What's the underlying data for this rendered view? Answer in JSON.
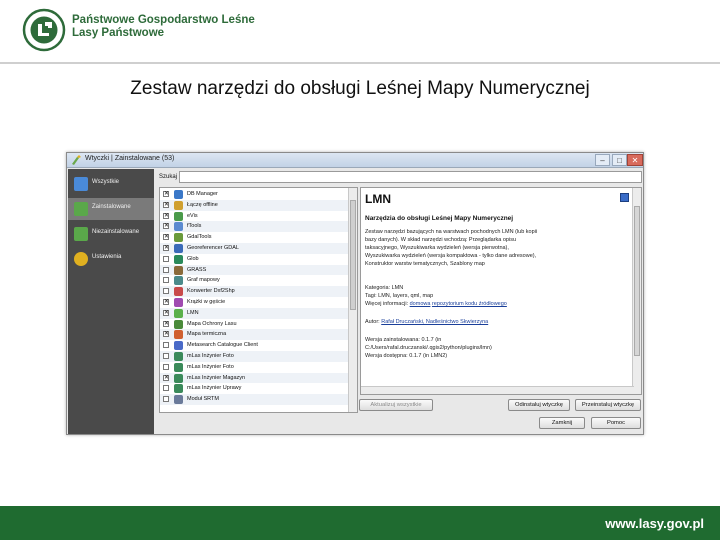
{
  "header": {
    "org_line1": "Państwowe Gospodarstwo Leśne",
    "org_line2": "Lasy Państwowe",
    "logo_text": "LASY PAŃSTWOWE",
    "brand_color": "#2e6b3a"
  },
  "slide_title": "Zestaw narzędzi do obsługi Leśnej Mapy Numerycznej",
  "window": {
    "title": "Wtyczki | Zainstalowane (53)",
    "controls": [
      "minimize-icon",
      "maximize-icon",
      "close-icon"
    ]
  },
  "nav": {
    "items": [
      {
        "label": "Wszystkie",
        "icon": "plugins-all-icon",
        "color": "#4a8ad8"
      },
      {
        "label": "Zainstalowane",
        "icon": "installed-icon",
        "color": "#5aa84a",
        "selected": true
      },
      {
        "label": "Niezainstalowane",
        "icon": "not-installed-icon",
        "color": "#5aa84a"
      },
      {
        "label": "Ustawienia",
        "icon": "settings-gear-icon",
        "color": "#e0b020"
      }
    ]
  },
  "search": {
    "label": "Szukaj",
    "value": ""
  },
  "plugins": [
    {
      "name": "DB Manager",
      "checked": true,
      "icon_color": "#3a78c8"
    },
    {
      "name": "Łączę offline",
      "checked": true,
      "icon_color": "#d0a030"
    },
    {
      "name": "eVis",
      "checked": true,
      "icon_color": "#4a9a4a"
    },
    {
      "name": "fTools",
      "checked": true,
      "icon_color": "#5a8ad0"
    },
    {
      "name": "GdalTools",
      "checked": true,
      "icon_color": "#6a9a3a"
    },
    {
      "name": "Georeferencer GDAL",
      "checked": true,
      "icon_color": "#3a6ab8"
    },
    {
      "name": "Glob",
      "checked": false,
      "icon_color": "#2a8a5a"
    },
    {
      "name": "GRASS",
      "checked": false,
      "icon_color": "#8a6a3a"
    },
    {
      "name": "Graf mapowy",
      "checked": false,
      "icon_color": "#4a8a8a"
    },
    {
      "name": "Konwerter Dxf2Shp",
      "checked": false,
      "icon_color": "#c84a4a"
    },
    {
      "name": "Krążki w gęście",
      "checked": true,
      "icon_color": "#a04ab0"
    },
    {
      "name": "LMN",
      "checked": true,
      "icon_color": "#5ab04a"
    },
    {
      "name": "Mapa Ochrony Lasu",
      "checked": true,
      "icon_color": "#4a8a3a"
    },
    {
      "name": "Mapa termiczna",
      "checked": true,
      "icon_color": "#d06030"
    },
    {
      "name": "Metasearch Catalogue Client",
      "checked": false,
      "icon_color": "#4a6ac8"
    },
    {
      "name": "mLas Inżynier Foto",
      "checked": false,
      "icon_color": "#3a8a5a"
    },
    {
      "name": "mLas Inżynier Foto",
      "checked": false,
      "icon_color": "#3a8a5a"
    },
    {
      "name": "mLas Inżynier Magazyn",
      "checked": true,
      "icon_color": "#3a8a5a"
    },
    {
      "name": "mLas Inżynier Uprawy",
      "checked": false,
      "icon_color": "#3a8a5a"
    },
    {
      "name": "Moduł SRTM",
      "checked": false,
      "icon_color": "#6a7a9a"
    }
  ],
  "details": {
    "title": "LMN",
    "heading": "Narzędzia do obsługi Leśnej Mapy Numerycznej",
    "desc_lines": [
      "Zestaw narzędzi bazujących na warstwach pochodnych LMN (lub kopii",
      "bazy danych). W skład narzędzi wchodzą: Przeglądarka opisu",
      "taksacyjnego, Wyszukiwarka wydzieleń (wersja pierwotna),",
      "Wyszukiwarka wydzieleń (wersja kompaktowa - tylko dane adresowe),",
      "Konstruktor warstw tematycznych, Szablony map"
    ],
    "category": "Kategoria: LMN",
    "tags": "Tagi: LMN, layers, qml, map",
    "more_info_prefix": "Więcej informacji:",
    "links": [
      "domowa",
      "repozytorium kodu źródłowego"
    ],
    "author_prefix": "Autor:",
    "author": "Rafał Druczański, Nadleśnictwo Skwierzyna",
    "installed_version": "Wersja zainstalowana: 0.1.7 (in",
    "installed_path": "C:/Users/rafal.druczanski/.qgis2/python/plugins/lmn)",
    "available_version": "Wersja dostępna: 0.1.7 (in LMN2)"
  },
  "buttons": {
    "upgrade_all": "Aktualizuj wszystkie",
    "uninstall": "Odinstaluj wtyczkę",
    "reinstall": "Przeinstaluj wtyczkę",
    "close": "Zamknij",
    "help": "Pomoc"
  },
  "footer": {
    "url": "www.lasy.gov.pl",
    "color": "#1f6b30"
  }
}
